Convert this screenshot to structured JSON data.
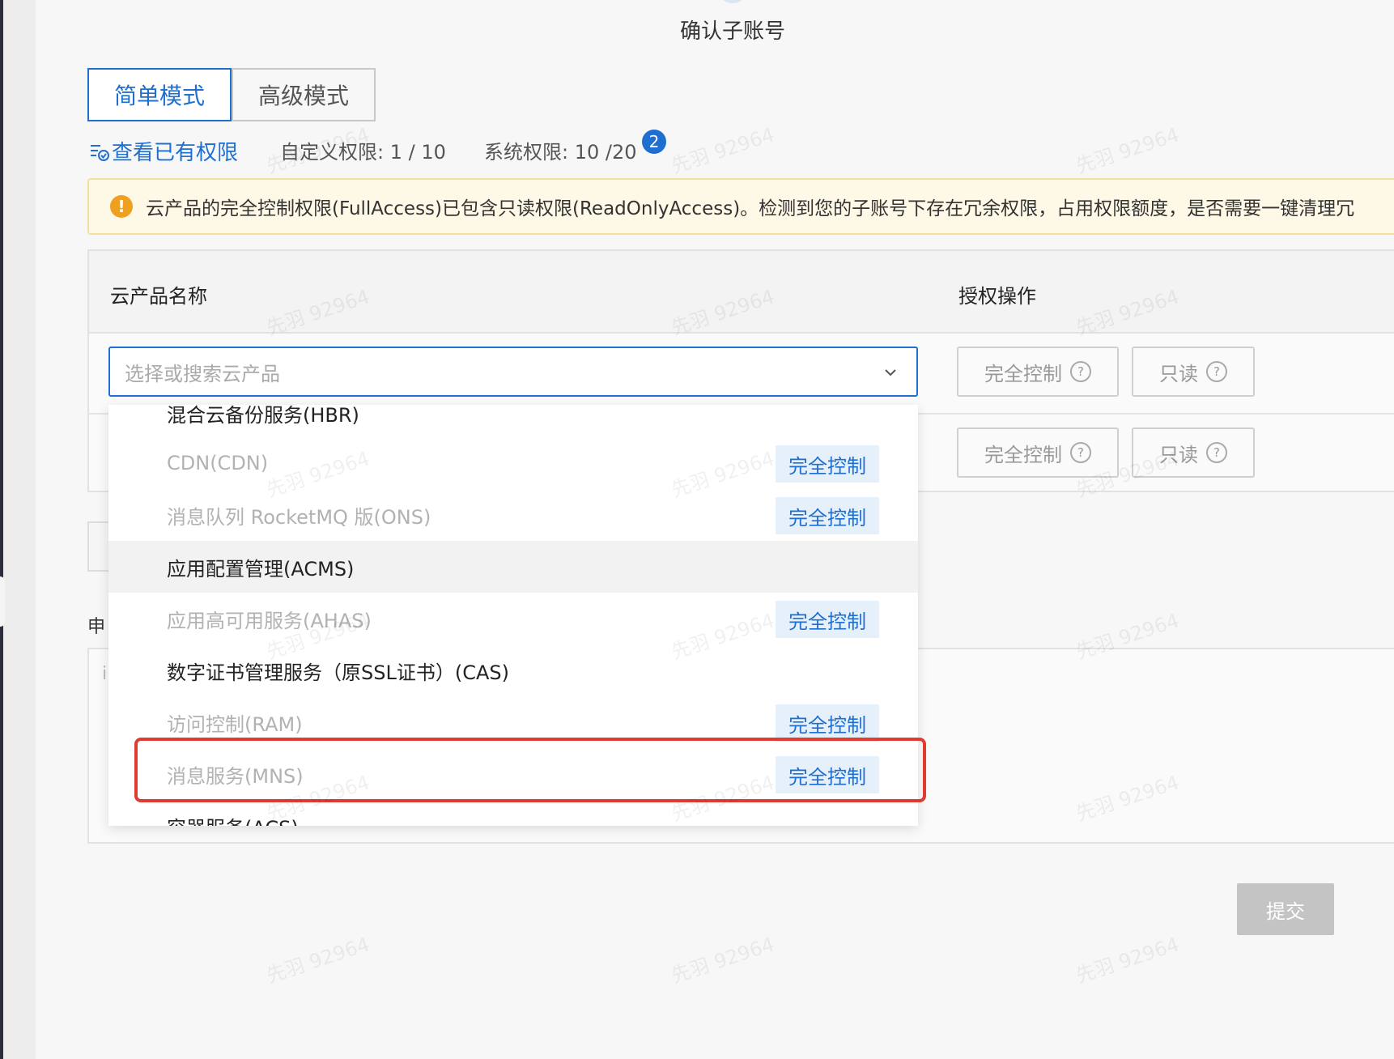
{
  "step_title": "确认子账号",
  "mode_tabs": {
    "simple": "简单模式",
    "advanced": "高级模式",
    "active": "simple"
  },
  "perm_summary": {
    "view_link": "查看已有权限",
    "custom": "自定义权限: 1 / 10",
    "system": "系统权限: 10 /20",
    "badge": "2"
  },
  "alert": {
    "text": "云产品的完全控制权限(FullAccess)已包含只读权限(ReadOnlyAccess)。检测到您的子账号下存在冗余权限，占用权限额度，是否需要一键清理冗"
  },
  "table": {
    "col_product": "云产品名称",
    "col_action": "授权操作",
    "select_placeholder": "选择或搜索云产品",
    "full_control": "完全控制",
    "read_only": "只读"
  },
  "dropdown": {
    "items": [
      {
        "label": "混合云备份服务(HBR)",
        "state": "enabled",
        "tag": ""
      },
      {
        "label": "CDN(CDN)",
        "state": "disabled",
        "tag": "完全控制"
      },
      {
        "label": "消息队列 RocketMQ 版(ONS)",
        "state": "disabled",
        "tag": "完全控制"
      },
      {
        "label": "应用配置管理(ACMS)",
        "state": "enabled",
        "tag": "",
        "hover": true
      },
      {
        "label": "应用高可用服务(AHAS)",
        "state": "disabled",
        "tag": "完全控制"
      },
      {
        "label": "数字证书管理服务（原SSL证书）(CAS)",
        "state": "enabled",
        "tag": ""
      },
      {
        "label": "访问控制(RAM)",
        "state": "disabled",
        "tag": "完全控制"
      },
      {
        "label": "消息服务(MNS)",
        "state": "disabled",
        "tag": "完全控制"
      },
      {
        "label": "容器服务(ACS)",
        "state": "enabled",
        "tag": ""
      }
    ]
  },
  "apply_label": "申",
  "textarea_stub": "i",
  "submit_label": "提交",
  "watermark": "先羽 92964",
  "colors": {
    "primary": "#1f6fd1",
    "warning": "#f0a020",
    "highlight": "#e03b30"
  }
}
